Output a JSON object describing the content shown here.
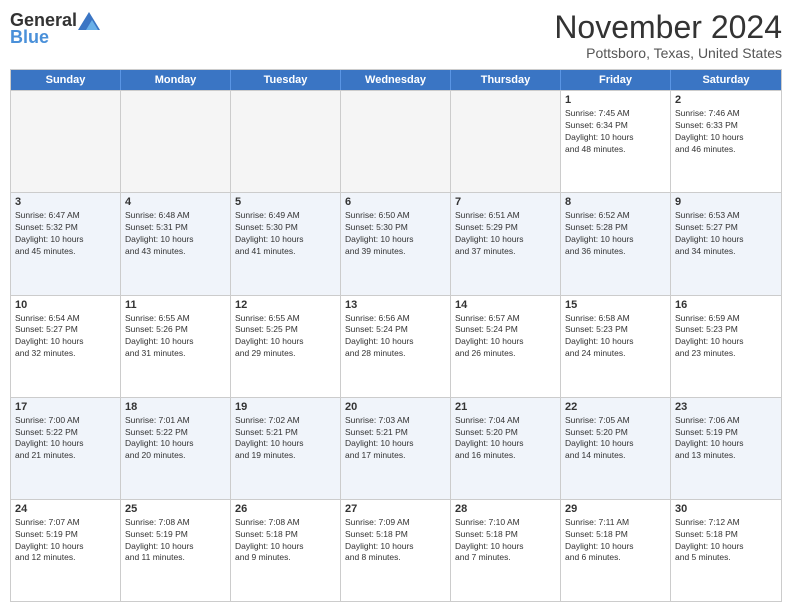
{
  "header": {
    "logo": {
      "general": "General",
      "blue": "Blue"
    },
    "month": "November 2024",
    "location": "Pottsboro, Texas, United States"
  },
  "days_of_week": [
    "Sunday",
    "Monday",
    "Tuesday",
    "Wednesday",
    "Thursday",
    "Friday",
    "Saturday"
  ],
  "rows": [
    {
      "alt": false,
      "cells": [
        {
          "empty": true,
          "day": "",
          "info": ""
        },
        {
          "empty": true,
          "day": "",
          "info": ""
        },
        {
          "empty": true,
          "day": "",
          "info": ""
        },
        {
          "empty": true,
          "day": "",
          "info": ""
        },
        {
          "empty": true,
          "day": "",
          "info": ""
        },
        {
          "empty": false,
          "day": "1",
          "info": "Sunrise: 7:45 AM\nSunset: 6:34 PM\nDaylight: 10 hours\nand 48 minutes."
        },
        {
          "empty": false,
          "day": "2",
          "info": "Sunrise: 7:46 AM\nSunset: 6:33 PM\nDaylight: 10 hours\nand 46 minutes."
        }
      ]
    },
    {
      "alt": true,
      "cells": [
        {
          "empty": false,
          "day": "3",
          "info": "Sunrise: 6:47 AM\nSunset: 5:32 PM\nDaylight: 10 hours\nand 45 minutes."
        },
        {
          "empty": false,
          "day": "4",
          "info": "Sunrise: 6:48 AM\nSunset: 5:31 PM\nDaylight: 10 hours\nand 43 minutes."
        },
        {
          "empty": false,
          "day": "5",
          "info": "Sunrise: 6:49 AM\nSunset: 5:30 PM\nDaylight: 10 hours\nand 41 minutes."
        },
        {
          "empty": false,
          "day": "6",
          "info": "Sunrise: 6:50 AM\nSunset: 5:30 PM\nDaylight: 10 hours\nand 39 minutes."
        },
        {
          "empty": false,
          "day": "7",
          "info": "Sunrise: 6:51 AM\nSunset: 5:29 PM\nDaylight: 10 hours\nand 37 minutes."
        },
        {
          "empty": false,
          "day": "8",
          "info": "Sunrise: 6:52 AM\nSunset: 5:28 PM\nDaylight: 10 hours\nand 36 minutes."
        },
        {
          "empty": false,
          "day": "9",
          "info": "Sunrise: 6:53 AM\nSunset: 5:27 PM\nDaylight: 10 hours\nand 34 minutes."
        }
      ]
    },
    {
      "alt": false,
      "cells": [
        {
          "empty": false,
          "day": "10",
          "info": "Sunrise: 6:54 AM\nSunset: 5:27 PM\nDaylight: 10 hours\nand 32 minutes."
        },
        {
          "empty": false,
          "day": "11",
          "info": "Sunrise: 6:55 AM\nSunset: 5:26 PM\nDaylight: 10 hours\nand 31 minutes."
        },
        {
          "empty": false,
          "day": "12",
          "info": "Sunrise: 6:55 AM\nSunset: 5:25 PM\nDaylight: 10 hours\nand 29 minutes."
        },
        {
          "empty": false,
          "day": "13",
          "info": "Sunrise: 6:56 AM\nSunset: 5:24 PM\nDaylight: 10 hours\nand 28 minutes."
        },
        {
          "empty": false,
          "day": "14",
          "info": "Sunrise: 6:57 AM\nSunset: 5:24 PM\nDaylight: 10 hours\nand 26 minutes."
        },
        {
          "empty": false,
          "day": "15",
          "info": "Sunrise: 6:58 AM\nSunset: 5:23 PM\nDaylight: 10 hours\nand 24 minutes."
        },
        {
          "empty": false,
          "day": "16",
          "info": "Sunrise: 6:59 AM\nSunset: 5:23 PM\nDaylight: 10 hours\nand 23 minutes."
        }
      ]
    },
    {
      "alt": true,
      "cells": [
        {
          "empty": false,
          "day": "17",
          "info": "Sunrise: 7:00 AM\nSunset: 5:22 PM\nDaylight: 10 hours\nand 21 minutes."
        },
        {
          "empty": false,
          "day": "18",
          "info": "Sunrise: 7:01 AM\nSunset: 5:22 PM\nDaylight: 10 hours\nand 20 minutes."
        },
        {
          "empty": false,
          "day": "19",
          "info": "Sunrise: 7:02 AM\nSunset: 5:21 PM\nDaylight: 10 hours\nand 19 minutes."
        },
        {
          "empty": false,
          "day": "20",
          "info": "Sunrise: 7:03 AM\nSunset: 5:21 PM\nDaylight: 10 hours\nand 17 minutes."
        },
        {
          "empty": false,
          "day": "21",
          "info": "Sunrise: 7:04 AM\nSunset: 5:20 PM\nDaylight: 10 hours\nand 16 minutes."
        },
        {
          "empty": false,
          "day": "22",
          "info": "Sunrise: 7:05 AM\nSunset: 5:20 PM\nDaylight: 10 hours\nand 14 minutes."
        },
        {
          "empty": false,
          "day": "23",
          "info": "Sunrise: 7:06 AM\nSunset: 5:19 PM\nDaylight: 10 hours\nand 13 minutes."
        }
      ]
    },
    {
      "alt": false,
      "cells": [
        {
          "empty": false,
          "day": "24",
          "info": "Sunrise: 7:07 AM\nSunset: 5:19 PM\nDaylight: 10 hours\nand 12 minutes."
        },
        {
          "empty": false,
          "day": "25",
          "info": "Sunrise: 7:08 AM\nSunset: 5:19 PM\nDaylight: 10 hours\nand 11 minutes."
        },
        {
          "empty": false,
          "day": "26",
          "info": "Sunrise: 7:08 AM\nSunset: 5:18 PM\nDaylight: 10 hours\nand 9 minutes."
        },
        {
          "empty": false,
          "day": "27",
          "info": "Sunrise: 7:09 AM\nSunset: 5:18 PM\nDaylight: 10 hours\nand 8 minutes."
        },
        {
          "empty": false,
          "day": "28",
          "info": "Sunrise: 7:10 AM\nSunset: 5:18 PM\nDaylight: 10 hours\nand 7 minutes."
        },
        {
          "empty": false,
          "day": "29",
          "info": "Sunrise: 7:11 AM\nSunset: 5:18 PM\nDaylight: 10 hours\nand 6 minutes."
        },
        {
          "empty": false,
          "day": "30",
          "info": "Sunrise: 7:12 AM\nSunset: 5:18 PM\nDaylight: 10 hours\nand 5 minutes."
        }
      ]
    }
  ]
}
